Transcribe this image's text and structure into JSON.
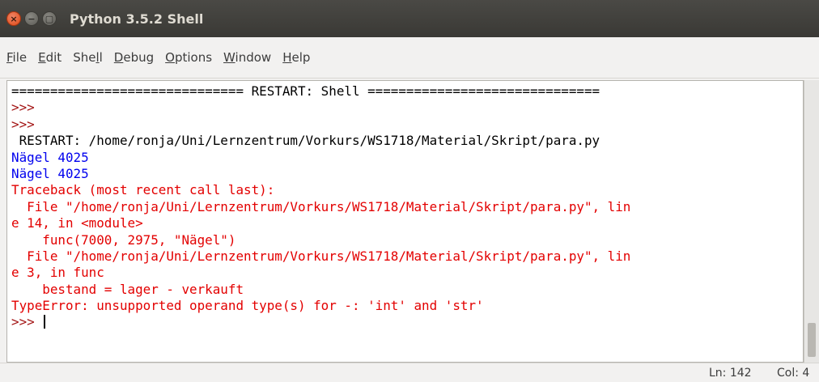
{
  "window": {
    "title": "Python 3.5.2 Shell",
    "buttons": {
      "close": "×",
      "minimize": "−",
      "maximize": "▢"
    }
  },
  "menu": [
    {
      "label": "File",
      "mnemonic_index": 0
    },
    {
      "label": "Edit",
      "mnemonic_index": 0
    },
    {
      "label": "Shell",
      "mnemonic_index": 3
    },
    {
      "label": "Debug",
      "mnemonic_index": 0
    },
    {
      "label": "Options",
      "mnemonic_index": 0
    },
    {
      "label": "Window",
      "mnemonic_index": 0
    },
    {
      "label": "Help",
      "mnemonic_index": 0
    }
  ],
  "shell": {
    "lines": [
      {
        "text": "============================== RESTART: Shell ==============================",
        "style": "black"
      },
      {
        "text": ">>> ",
        "style": "prompt"
      },
      {
        "text": ">>> ",
        "style": "prompt"
      },
      {
        "text": " RESTART: /home/ronja/Uni/Lernzentrum/Vorkurs/WS1718/Material/Skript/para.py",
        "style": "black"
      },
      {
        "text": "Nägel 4025",
        "style": "blue"
      },
      {
        "text": "Nägel 4025",
        "style": "blue"
      },
      {
        "text": "Traceback (most recent call last):",
        "style": "red"
      },
      {
        "text": "  File \"/home/ronja/Uni/Lernzentrum/Vorkurs/WS1718/Material/Skript/para.py\", lin",
        "style": "red"
      },
      {
        "text": "e 14, in <module>",
        "style": "red"
      },
      {
        "text": "    func(7000, 2975, \"Nägel\")",
        "style": "red"
      },
      {
        "text": "  File \"/home/ronja/Uni/Lernzentrum/Vorkurs/WS1718/Material/Skript/para.py\", lin",
        "style": "red"
      },
      {
        "text": "e 3, in func",
        "style": "red"
      },
      {
        "text": "    bestand = lager - verkauft",
        "style": "red"
      },
      {
        "text": "TypeError: unsupported operand type(s) for -: 'int' and 'str'",
        "style": "red"
      }
    ],
    "current_prompt": ">>> "
  },
  "status": {
    "line": "Ln: 142",
    "col": "Col: 4"
  },
  "colors": {
    "titlebar": "#3c3b37",
    "title_text": "#dfdbd2",
    "prompt": "#a31515",
    "stdout": "#0000ee",
    "stderr": "#e30000",
    "background": "#ffffff"
  }
}
